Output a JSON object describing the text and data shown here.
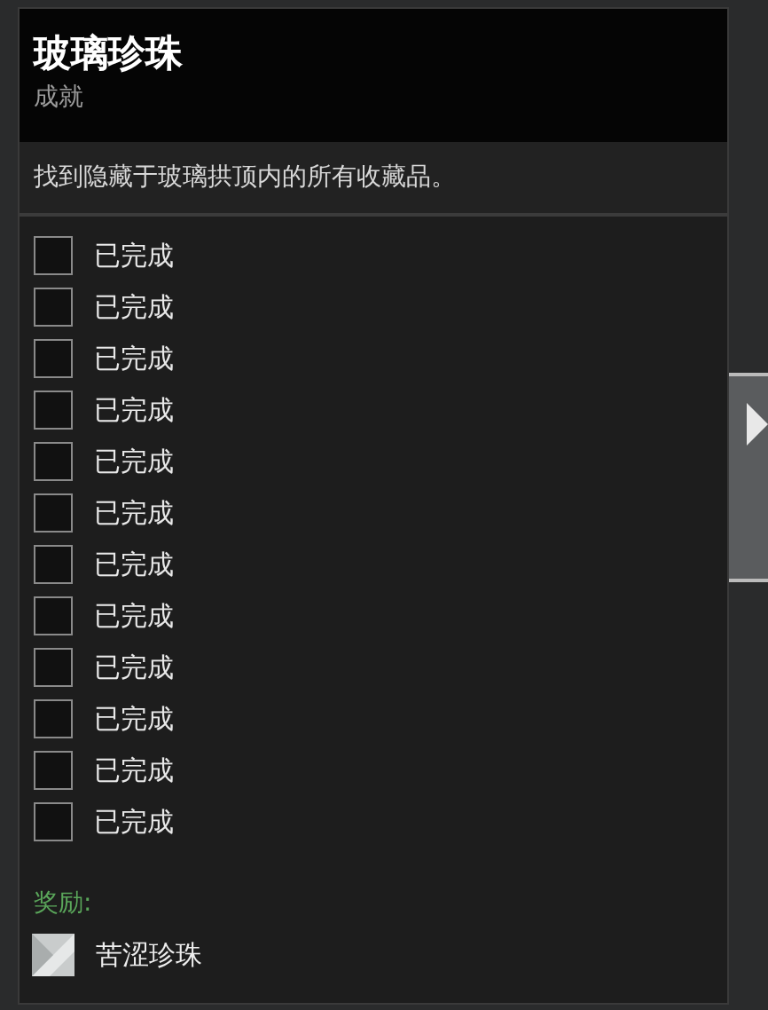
{
  "tooltip": {
    "title": "玻璃珍珠",
    "subtitle": "成就",
    "description": "找到隐藏于玻璃拱顶内的所有收藏品。",
    "objectives": [
      {
        "label": "已完成",
        "checked": false
      },
      {
        "label": "已完成",
        "checked": false
      },
      {
        "label": "已完成",
        "checked": false
      },
      {
        "label": "已完成",
        "checked": false
      },
      {
        "label": "已完成",
        "checked": false
      },
      {
        "label": "已完成",
        "checked": false
      },
      {
        "label": "已完成",
        "checked": false
      },
      {
        "label": "已完成",
        "checked": false
      },
      {
        "label": "已完成",
        "checked": false
      },
      {
        "label": "已完成",
        "checked": false
      },
      {
        "label": "已完成",
        "checked": false
      },
      {
        "label": "已完成",
        "checked": false
      }
    ],
    "reward_label": "奖励:",
    "reward": {
      "name": "苦涩珍珠"
    }
  }
}
